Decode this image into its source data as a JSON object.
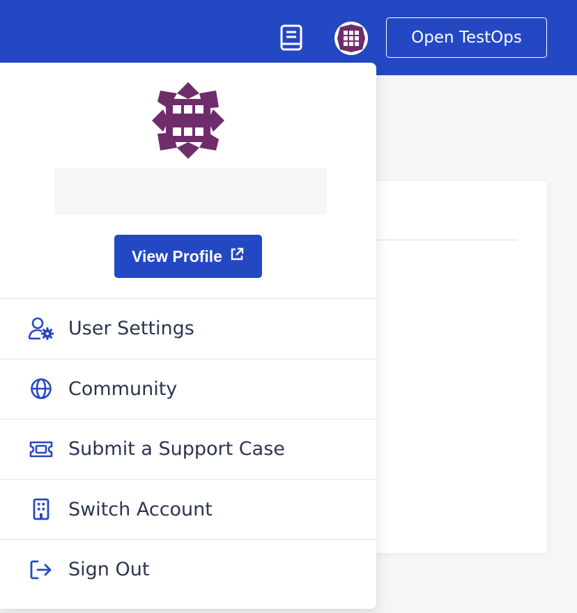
{
  "header": {
    "open_button_label": "Open TestOps",
    "icons": [
      "book-icon",
      "user-avatar"
    ]
  },
  "profile": {
    "view_profile_label": "View Profile"
  },
  "menu": {
    "items": [
      {
        "label": "User Settings",
        "icon": "user-settings-icon"
      },
      {
        "label": "Community",
        "icon": "globe-icon"
      },
      {
        "label": "Submit a Support Case",
        "icon": "ticket-icon"
      },
      {
        "label": "Switch Account",
        "icon": "building-icon"
      },
      {
        "label": "Sign Out",
        "icon": "sign-out-icon"
      }
    ]
  },
  "colors": {
    "brand": "#2448c4",
    "avatar": "#6f2c6b",
    "text": "#2a3550",
    "icon": "#2448c4"
  }
}
